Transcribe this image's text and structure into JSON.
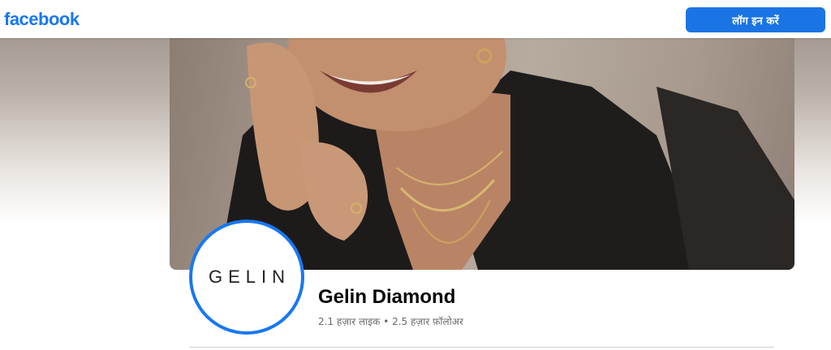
{
  "header": {
    "logo_text": "facebook",
    "login_label": "लॉग इन करें",
    "brand_color": "#1877f2"
  },
  "profile": {
    "avatar_text": "GELIN",
    "name": "Gelin Diamond",
    "likes": "2.1 हज़ार लाइक",
    "separator": "•",
    "followers": "2.5 हज़ार फ़ॉलोअर"
  }
}
